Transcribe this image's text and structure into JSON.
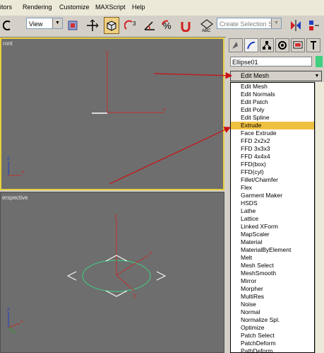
{
  "menubar": {
    "items": [
      "itors",
      "Rendering",
      "Customize",
      "MAXScript",
      "Help"
    ]
  },
  "toolbar": {
    "view_select": "View",
    "selection_set_placeholder": "Create Selection Set",
    "icons": [
      "undo-icon",
      "view-dropdown",
      "select-object-icon",
      "move-icon",
      "select-rotate-icon",
      "snap-3d-icon",
      "angle-snap-icon",
      "percent-snap-icon",
      "spinner-snap-icon",
      "edit-named-selection-icon",
      "mirror-icon",
      "align-icon"
    ]
  },
  "viewports": {
    "front_label": "ront",
    "perspective_label": "erspective",
    "axis_x": "x",
    "axis_y": "y",
    "axis_z": "z"
  },
  "panel": {
    "object_name": "Ellipse01",
    "object_color": "#40d080",
    "modifier_selected": "Edit Mesh",
    "modifier_list": [
      "Edit Mesh",
      "Edit Normals",
      "Edit Patch",
      "Edit Poly",
      "Edit Spline",
      "Extrude",
      "Face Extrude",
      "FFD 2x2x2",
      "FFD 3x3x3",
      "FFD 4x4x4",
      "FFD(box)",
      "FFD(cyl)",
      "Fillet/Chamfer",
      "Flex",
      "Garment Maker",
      "HSDS",
      "Lathe",
      "Lattice",
      "Linked XForm",
      "MapScaler",
      "Material",
      "MaterialByElement",
      "Melt",
      "Mesh Select",
      "MeshSmooth",
      "Mirror",
      "Morpher",
      "MultiRes",
      "Noise",
      "Normal",
      "Normalize Spl.",
      "Optimize",
      "Patch Select",
      "PatchDeform",
      "PathDeform"
    ],
    "highlighted_index": 5,
    "highlight_color": "#f0c040"
  },
  "annotations": {
    "arrow_color": "#cc1010"
  }
}
